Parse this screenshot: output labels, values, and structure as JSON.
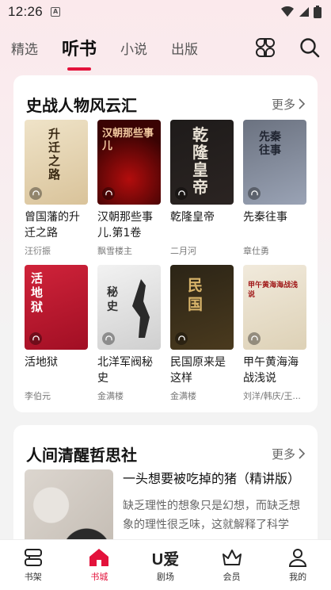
{
  "status": {
    "time": "12:26",
    "sim_label": "A"
  },
  "top_tabs": [
    {
      "label": "精选"
    },
    {
      "label": "听书"
    },
    {
      "label": "小说"
    },
    {
      "label": "出版"
    }
  ],
  "section1": {
    "title": "史战人物风云汇",
    "more": "更多",
    "books": [
      {
        "title": "曾国藩的升迁之路",
        "author": "汪衍振",
        "cover_text": "升迁之路"
      },
      {
        "title": "汉朝那些事儿.第1卷",
        "author": "飘雪楼主",
        "cover_text": "汉朝那些事儿"
      },
      {
        "title": "乾隆皇帝",
        "author": "二月河",
        "cover_text": "乾隆皇帝"
      },
      {
        "title": "先秦往事",
        "author": "章仕勇",
        "cover_text": "先秦往事"
      },
      {
        "title": "活地狱",
        "author": "李伯元",
        "cover_text": "活地狱"
      },
      {
        "title": "北洋军阀秘史",
        "author": "金满楼",
        "cover_text": "秘史"
      },
      {
        "title": "民国原来是这样",
        "author": "金满楼",
        "cover_text": "民国"
      },
      {
        "title": "甲午黄海海战浅说",
        "author": "刘洋/韩庆/王...",
        "cover_text": "甲午黄海海战浅说"
      }
    ]
  },
  "section2": {
    "title": "人间清醒哲思社",
    "more": "更多",
    "feature": {
      "title": "一头想要被吃掉的猪（精讲版）",
      "desc": "缺乏理性的想象只是幻想，而缺乏想象的理性很乏味，这就解释了科学家..."
    }
  },
  "bottom_nav": [
    {
      "label": "书架"
    },
    {
      "label": "书城"
    },
    {
      "label": "剧场",
      "logo_text": "U爱"
    },
    {
      "label": "会员"
    },
    {
      "label": "我的"
    }
  ],
  "colors": {
    "accent": "#e3123b",
    "card_bg": "#ffffff"
  }
}
